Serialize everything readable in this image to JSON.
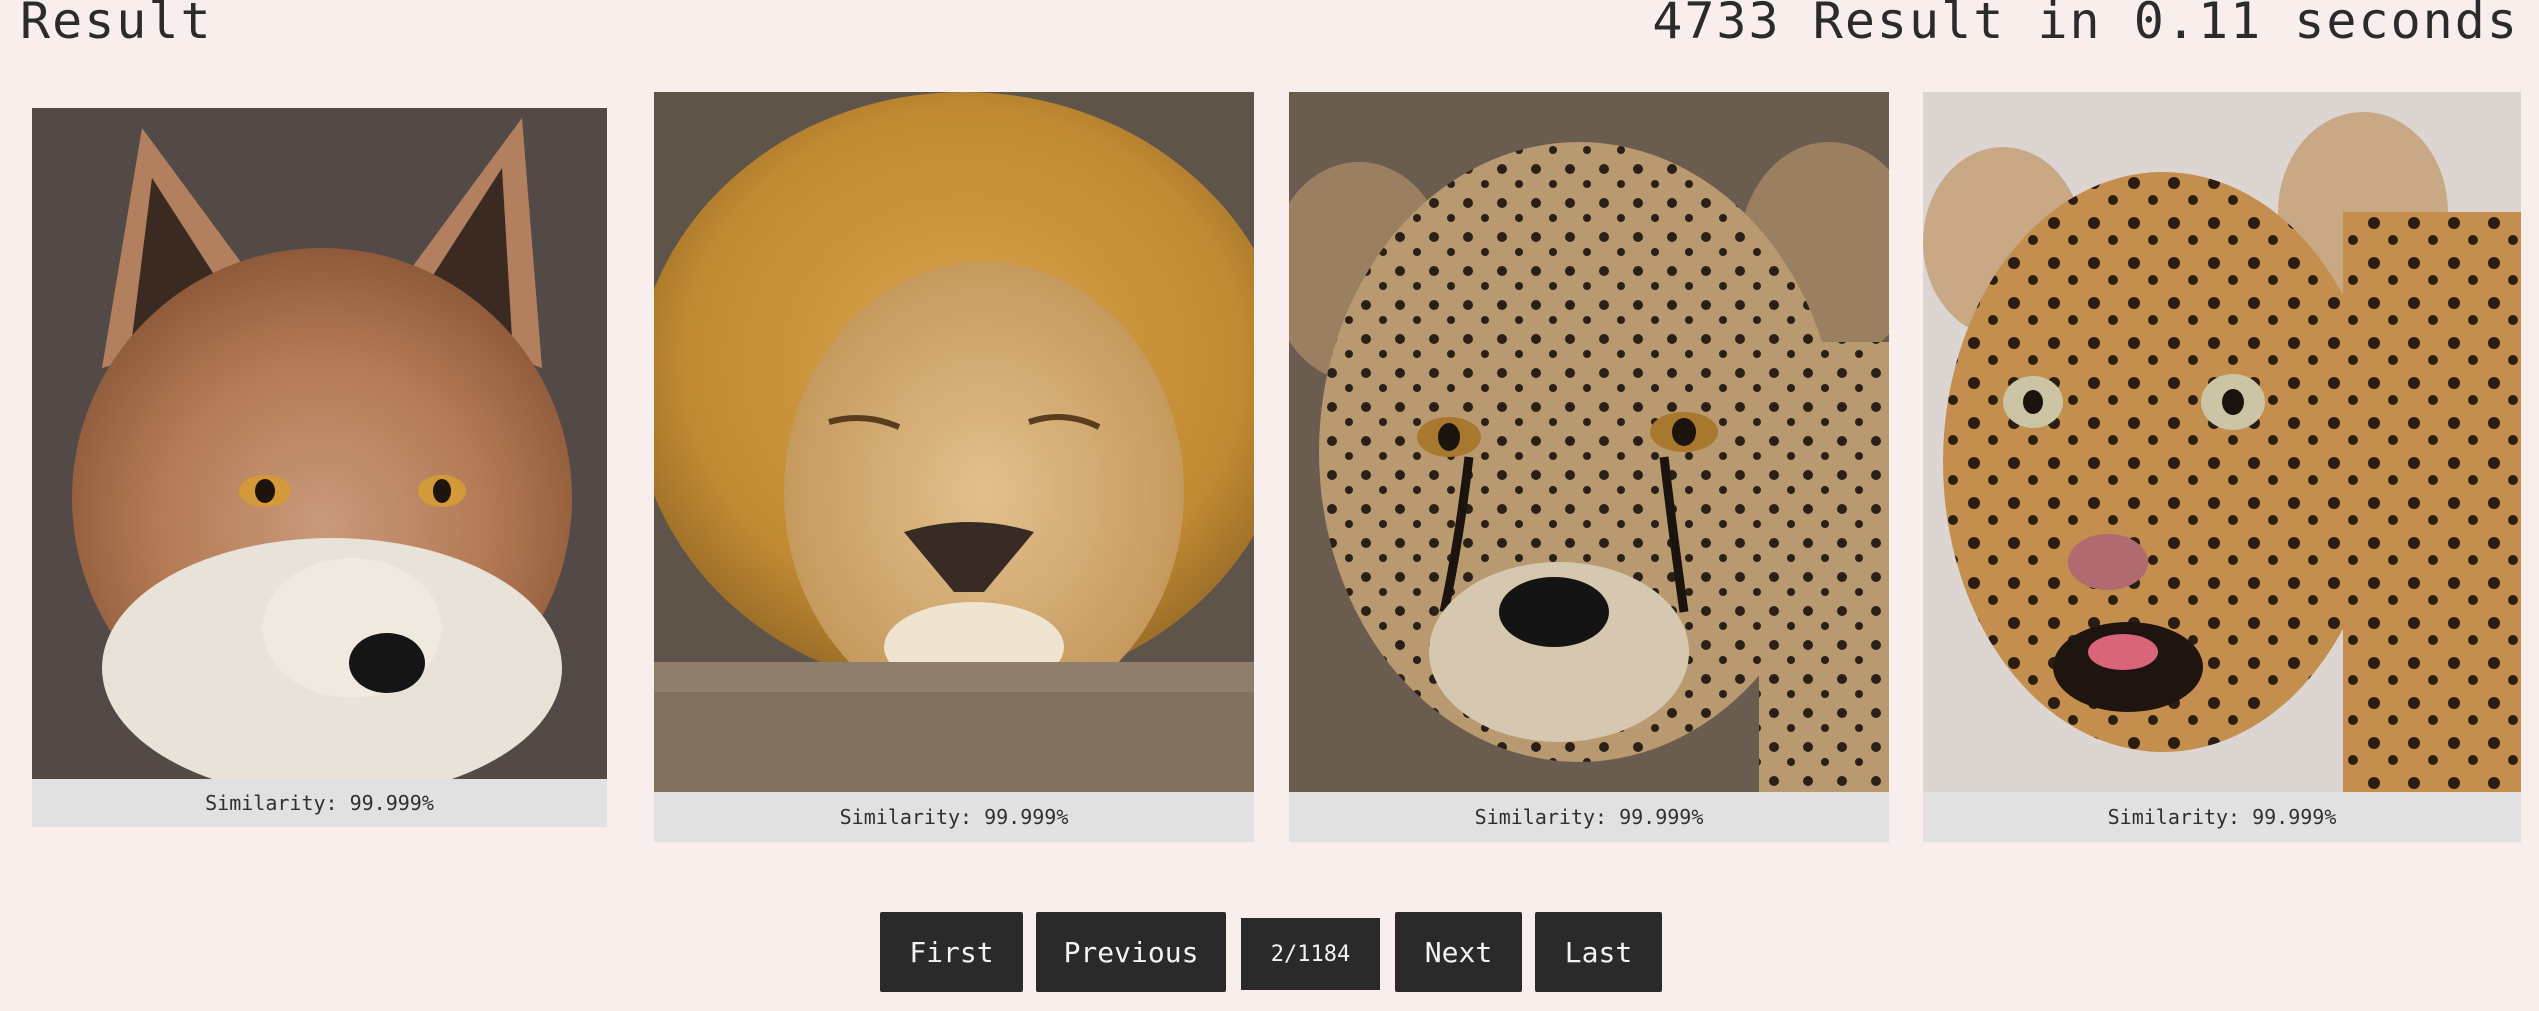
{
  "header": {
    "title": "Result",
    "stats": "4733 Result in 0.11 seconds"
  },
  "results": [
    {
      "animal": "fox-image",
      "caption": "Similarity: 99.999%"
    },
    {
      "animal": "lion-image",
      "caption": "Similarity: 99.999%"
    },
    {
      "animal": "cheetah-image",
      "caption": "Similarity: 99.999%"
    },
    {
      "animal": "leopard-image",
      "caption": "Similarity: 99.999%"
    }
  ],
  "pagination": {
    "first_label": "First",
    "previous_label": "Previous",
    "page_indicator": "2/1184",
    "next_label": "Next",
    "last_label": "Last"
  },
  "colors": {
    "background": "#f8efec",
    "caption_bg": "#e1e1e1",
    "button_bg": "#2a2a2a",
    "button_text": "#f3f3f3"
  }
}
